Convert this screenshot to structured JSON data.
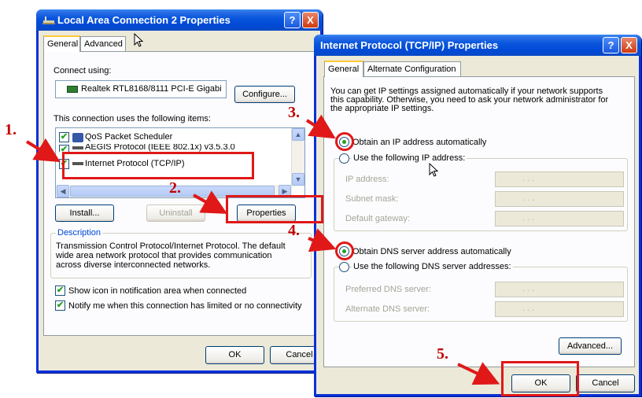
{
  "lan_dialog": {
    "title": "Local Area Connection 2 Properties",
    "help_btn": "?",
    "close_btn": "X",
    "tab_general": "General",
    "tab_advanced": "Advanced",
    "connect_using_label": "Connect using:",
    "adapter_name": "Realtek RTL8168/8111 PCI-E Gigabi",
    "configure_button": "Configure...",
    "items_label": "This connection uses the following items:",
    "items": [
      {
        "label": "QoS Packet Scheduler",
        "checked": true
      },
      {
        "label": "AEGIS Protocol (IEEE 802.1x) v3.5.3.0",
        "checked": true
      },
      {
        "label": "Internet Protocol (TCP/IP)",
        "checked": true
      }
    ],
    "install_button": "Install...",
    "uninstall_button": "Uninstall",
    "properties_button": "Properties",
    "description_label": "Description",
    "description_text_1": "Transmission Control Protocol/Internet Protocol. The default",
    "description_text_2": "wide area network protocol that provides communication",
    "description_text_3": "across diverse interconnected networks.",
    "show_icon_label": "Show icon in notification area when connected",
    "notify_label": "Notify me when this connection has limited or no connectivity",
    "ok_button": "OK",
    "cancel_button": "Cancel"
  },
  "tcpip_dialog": {
    "title": "Internet Protocol (TCP/IP) Properties",
    "help_btn": "?",
    "close_btn": "X",
    "tab_general": "General",
    "tab_alternate": "Alternate Configuration",
    "intro_1": "You can get IP settings assigned automatically if your network supports",
    "intro_2": "this capability. Otherwise, you need to ask your network administrator for",
    "intro_3": "the appropriate IP settings.",
    "obtain_ip_label": "Obtain an IP address automatically",
    "use_ip_label": "Use the following IP address:",
    "ip_address_label": "IP address:",
    "subnet_mask_label": "Subnet mask:",
    "gateway_label": "Default gateway:",
    "obtain_dns_label": "Obtain DNS server address automatically",
    "use_dns_label": "Use the following DNS server addresses:",
    "preferred_dns_label": "Preferred DNS server:",
    "alternate_dns_label": "Alternate DNS server:",
    "ip_placeholder": ".       .       .",
    "advanced_button": "Advanced...",
    "ok_button": "OK",
    "cancel_button": "Cancel"
  },
  "annotations": {
    "step1": "1.",
    "step2": "2.",
    "step3": "3.",
    "step4": "4.",
    "step5": "5."
  },
  "colors": {
    "xp_title_blue": "#0a56dd",
    "annotation_red": "#e01818",
    "marker_red": "#c00000"
  }
}
